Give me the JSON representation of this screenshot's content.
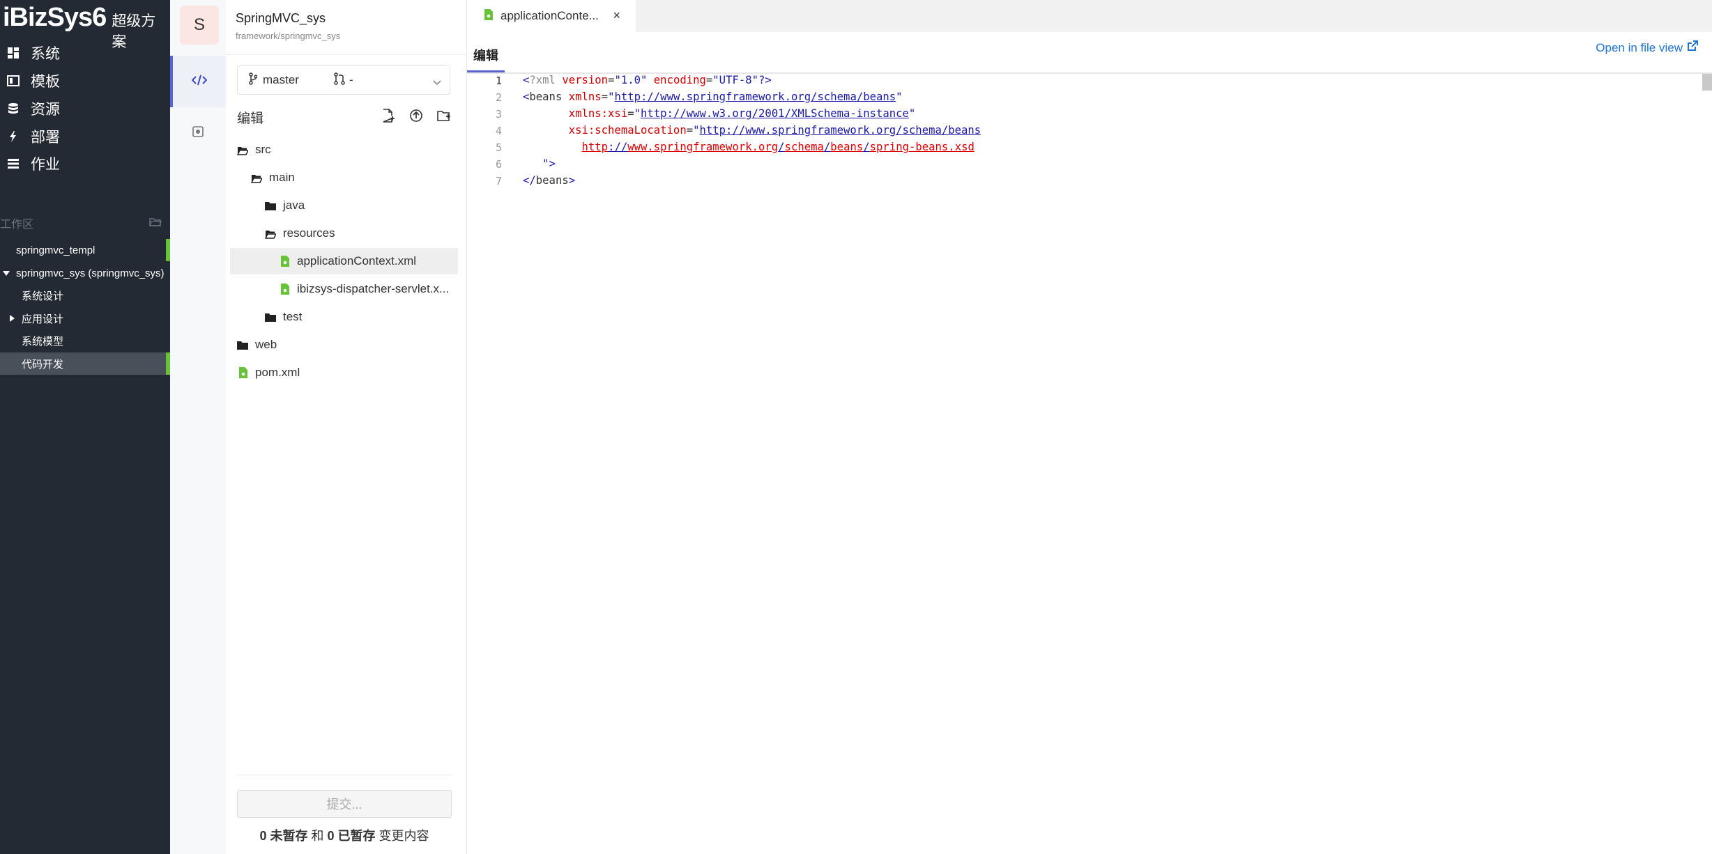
{
  "brand": {
    "logo": "iBizSys6",
    "sub": "超级方案"
  },
  "nav": [
    {
      "label": "系统",
      "icon": "dashboard-icon"
    },
    {
      "label": "模板",
      "icon": "template-icon"
    },
    {
      "label": "资源",
      "icon": "database-icon"
    },
    {
      "label": "部署",
      "icon": "lightning-icon"
    },
    {
      "label": "作业",
      "icon": "list-icon"
    }
  ],
  "workspace": {
    "title": "工作区",
    "items": [
      {
        "label": "springmvc_templ"
      },
      {
        "label": "springmvc_sys (springmvc_sys)"
      },
      {
        "label": "系统设计"
      },
      {
        "label": "应用设计"
      },
      {
        "label": "系统模型"
      },
      {
        "label": "代码开发"
      }
    ]
  },
  "project": {
    "avatar": "S",
    "title": "SpringMVC_sys",
    "path": "framework/springmvc_sys"
  },
  "branch": {
    "name": "master",
    "mr": "-"
  },
  "panel": {
    "edit_label": "编辑"
  },
  "tree": [
    {
      "label": "src"
    },
    {
      "label": "main"
    },
    {
      "label": "java"
    },
    {
      "label": "resources"
    },
    {
      "label": "applicationContext.xml"
    },
    {
      "label": "ibizsys-dispatcher-servlet.x..."
    },
    {
      "label": "test"
    },
    {
      "label": "web"
    },
    {
      "label": "pom.xml"
    }
  ],
  "commit": {
    "button": "提交...",
    "unstaged_count": "0",
    "unstaged_label": "未暂存",
    "and": "和",
    "staged_count": "0",
    "staged_label": "已暂存",
    "changes": "变更内容"
  },
  "editor": {
    "tab": "applicationConte...",
    "close": "×",
    "mode": "编辑",
    "open_link": "Open in file view",
    "lines": [
      "1",
      "2",
      "3",
      "4",
      "5",
      "6",
      "7"
    ]
  }
}
